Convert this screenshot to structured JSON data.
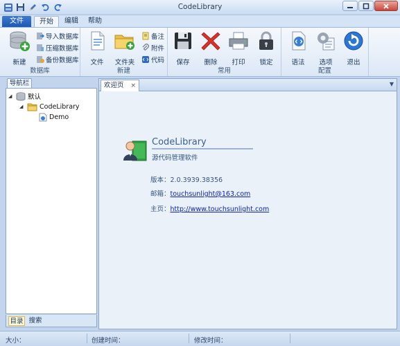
{
  "window": {
    "title": "CodeLibrary"
  },
  "ribbon": {
    "tabs": {
      "file": "文件",
      "start": "开始",
      "edit": "编辑",
      "help": "帮助"
    },
    "groups": {
      "database": {
        "label": "数据库",
        "new": "新建",
        "import": "导入数据库",
        "compress": "压缩数据库",
        "backup": "备份数据库"
      },
      "create": {
        "label": "新建",
        "file": "文件",
        "folder": "文件夹",
        "note": "备注",
        "attachment": "附件",
        "code": "代码"
      },
      "common": {
        "label": "常用",
        "save": "保存",
        "delete": "删除",
        "print": "打印",
        "lock": "锁定"
      },
      "config": {
        "label": "配置",
        "syntax": "语法",
        "options": "选项",
        "exit": "退出"
      }
    }
  },
  "nav": {
    "title": "导航栏",
    "tree": {
      "root": "默认",
      "library": "CodeLibrary",
      "item": "Demo"
    },
    "tabs": {
      "catalog": "目录",
      "search": "搜索"
    }
  },
  "document": {
    "tab_label": "欢迎页",
    "tab_close": "×",
    "menu_glyph": "▼",
    "app_name": "CodeLibrary",
    "app_desc": "源代码管理软件",
    "version_label": "版本：",
    "version_value": "2.0.3939.38356",
    "email_label": "邮箱：",
    "email_value": "touchsunlight@163.com",
    "homepage_label": "主页：",
    "homepage_value": "http://www.touchsunlight.com"
  },
  "status": {
    "size": "大小：",
    "created": "创建时间：",
    "modified": "修改时间："
  },
  "colors": {
    "file_tab": "#1b56b0",
    "link": "#0b22c4",
    "ribbon_bg": "#dce8f6",
    "close_button": "#c9473a"
  }
}
